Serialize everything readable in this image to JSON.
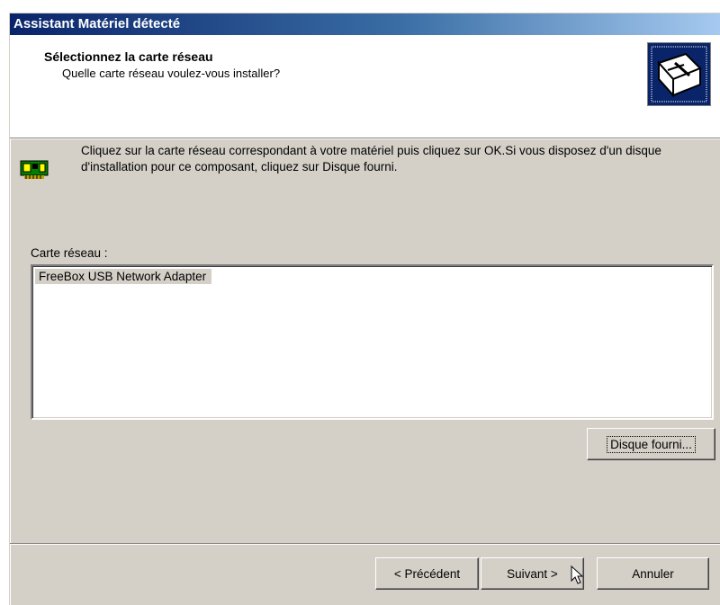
{
  "window": {
    "title": "Assistant Matériel détecté"
  },
  "header": {
    "title": "Sélectionnez la carte réseau",
    "subtitle": "Quelle carte réseau voulez-vous installer?",
    "icon": "hardware-wizard-icon"
  },
  "info": {
    "icon": "network-card-icon",
    "text": "Cliquez sur la carte réseau correspondant à votre matériel puis cliquez sur OK.Si vous disposez d'un disque d'installation pour ce composant, cliquez sur Disque fourni."
  },
  "list": {
    "label": "Carte réseau :",
    "items": [
      "FreeBox USB Network Adapter"
    ]
  },
  "buttons": {
    "have_disk": "Disque fourni...",
    "back": "< Précédent",
    "next": "Suivant >",
    "cancel": "Annuler"
  },
  "colors": {
    "titlebar_start": "#0a246a",
    "titlebar_end": "#a6caf0",
    "dialog_bg": "#d4d0c8"
  }
}
